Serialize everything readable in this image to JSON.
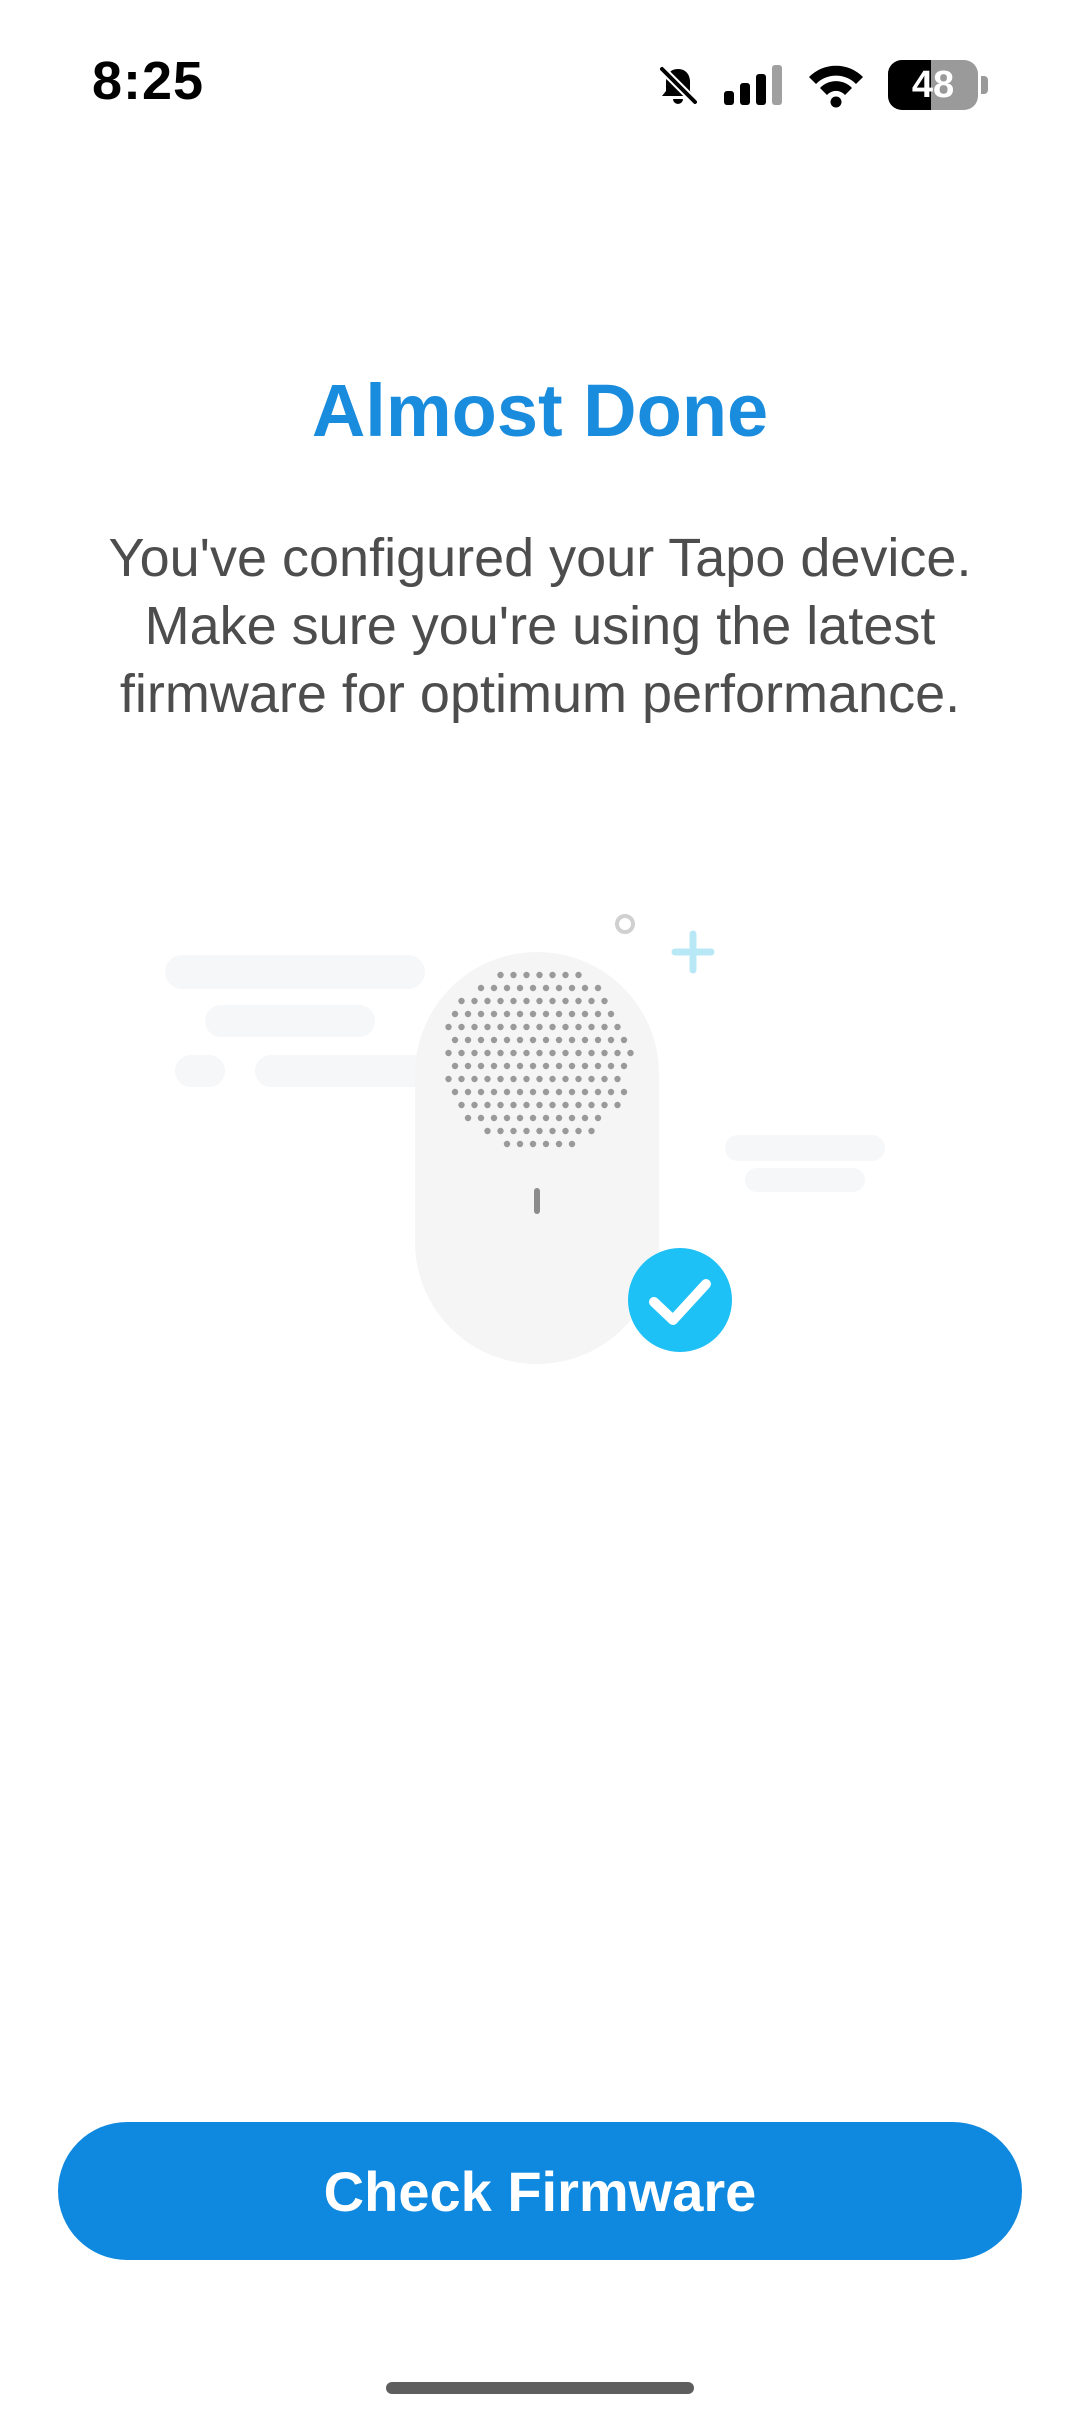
{
  "status_bar": {
    "time": "8:25",
    "icons": [
      "mute-bell-icon",
      "cellular-signal-icon",
      "wifi-icon",
      "battery-icon"
    ],
    "battery_level": "48",
    "battery_fraction": 0.48
  },
  "main": {
    "title": "Almost Done",
    "description": "You've configured your Tapo device. Make sure you're using the latest firmware for optimum performance.",
    "illustration_icon": "smart-speaker-device-icon",
    "status_icon": "checkmark-icon"
  },
  "actions": {
    "check_firmware_label": "Check Firmware"
  },
  "colors": {
    "accent": "#1a8cde",
    "button": "#0f89df",
    "check_badge": "#1ec1f5",
    "body_text": "#4d4d4d"
  }
}
